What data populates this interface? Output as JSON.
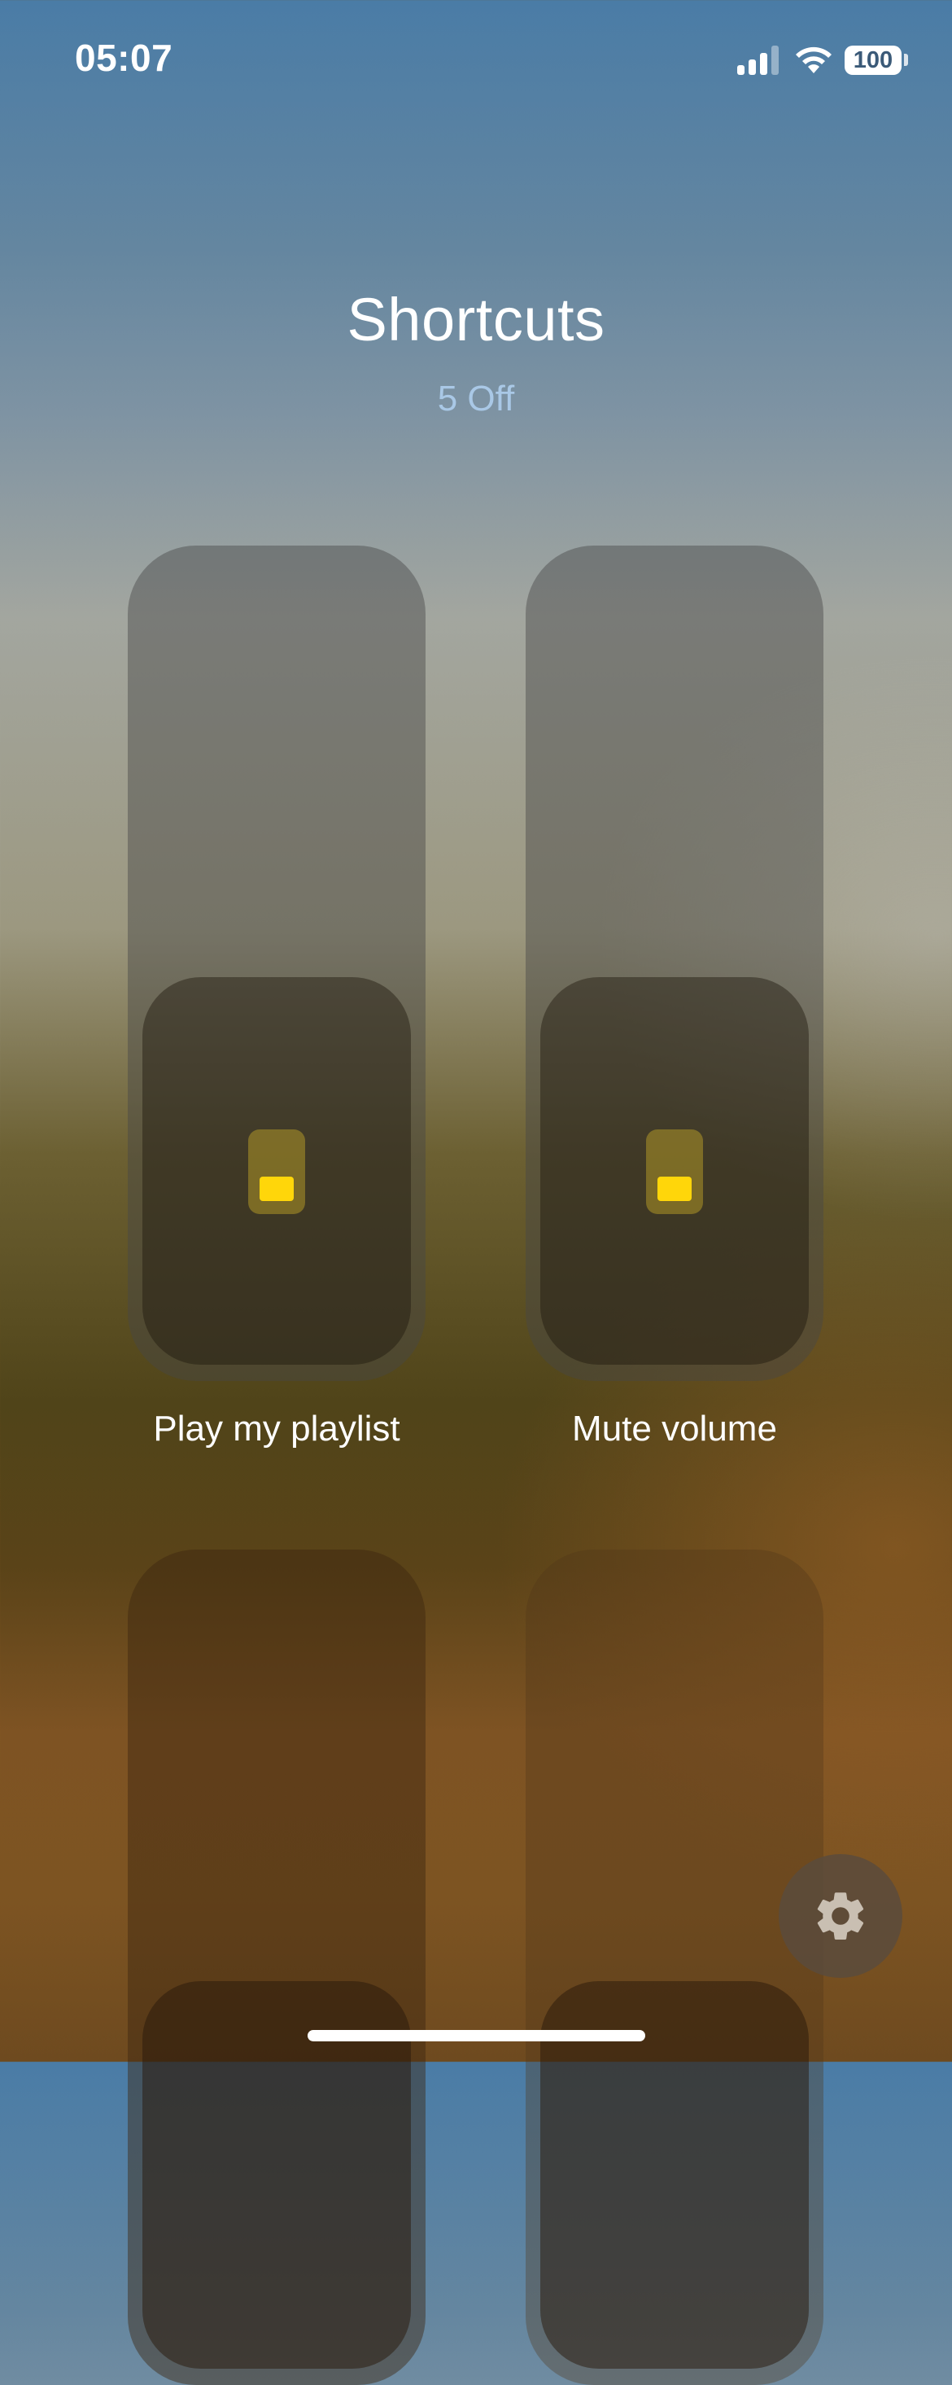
{
  "status_bar": {
    "time": "05:07",
    "battery": "100"
  },
  "header": {
    "title": "Shortcuts",
    "subtitle": "5 Off"
  },
  "shortcuts": [
    {
      "label": "Play my playlist",
      "state": "off"
    },
    {
      "label": "Mute volume",
      "state": "off"
    },
    {
      "label": "",
      "state": "off"
    },
    {
      "label": "",
      "state": "off"
    }
  ],
  "icons": {
    "settings": "gear-icon",
    "toggle": "toggle-switch-icon"
  },
  "colors": {
    "accent": "#ffd60a",
    "subtitle": "#a9c8e6"
  }
}
